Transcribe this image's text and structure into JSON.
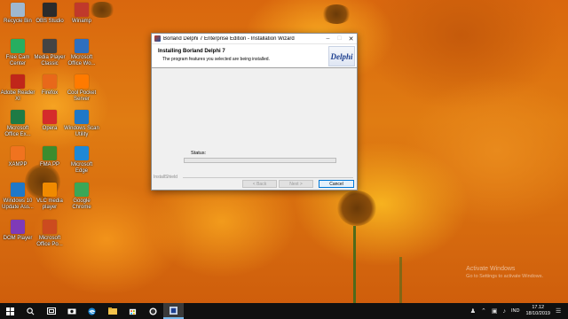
{
  "desktop_icons": [
    {
      "label": "Recycle Bin",
      "color": "#9fb8d0"
    },
    {
      "label": "OBS Studio",
      "color": "#2b2b2b"
    },
    {
      "label": "Winamp",
      "color": "#c0392b"
    },
    {
      "label": "Free Cam Center",
      "color": "#27ae60"
    },
    {
      "label": "Media Player Classic",
      "color": "#444444"
    },
    {
      "label": "Microsoft Office Wo...",
      "color": "#2e6fbf"
    },
    {
      "label": "Adobe Reader XI",
      "color": "#c0261a"
    },
    {
      "label": "Firefox",
      "color": "#e8681a"
    },
    {
      "label": "Cool Pocket Server",
      "color": "#ff7a00"
    },
    {
      "label": "Microsoft Office Ex...",
      "color": "#1e7b45"
    },
    {
      "label": "Opera",
      "color": "#d52b2b"
    },
    {
      "label": "Windows Scan Utility",
      "color": "#1f78c8"
    },
    {
      "label": "XAMPP",
      "color": "#f0731f"
    },
    {
      "label": "FMA PP",
      "color": "#3c8c2e"
    },
    {
      "label": "Microsoft Edge",
      "color": "#1e88d6"
    },
    {
      "label": "Windows 10 Update Ass...",
      "color": "#1f78c8"
    },
    {
      "label": "VLC media player",
      "color": "#f08a00"
    },
    {
      "label": "Google Chrome",
      "color": "#3aa757"
    },
    {
      "label": "DOM Player",
      "color": "#7f3ab8"
    },
    {
      "label": "Microsoft Office Po...",
      "color": "#cc4b1f"
    }
  ],
  "installer": {
    "title": "Borland Delphi 7 Enterprise Edition - Installation Wizard",
    "minimize": "–",
    "maximize": "□",
    "close": "✕",
    "heading": "Installing Borland Delphi 7",
    "description": "The program features you selected are being installed.",
    "logo_text": "Delphi",
    "status_label": "Status:",
    "progress": 0.0,
    "brand": "InstallShield",
    "back_label": "< Back",
    "next_label": "Next >",
    "cancel_label": "Cancel",
    "progress_color": "#06b025"
  },
  "watermark": {
    "line1": "Activate Windows",
    "line2": "Go to Settings to activate Windows."
  },
  "taskbar": {
    "start_icon": "windows-start-icon",
    "search_icon": "search-icon",
    "tray_lang": "IND",
    "time": "17.12",
    "date": "18/10/2019"
  }
}
